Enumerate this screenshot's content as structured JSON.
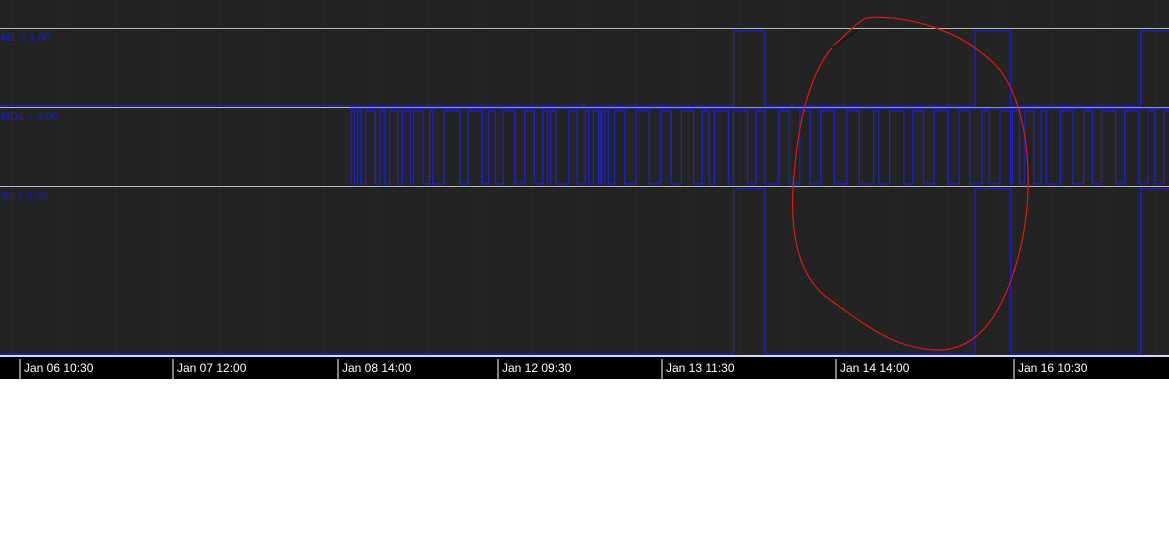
{
  "colors": {
    "panel_background": "#232323",
    "axis_bar": "#000000",
    "signal": "#1f1fcc",
    "annotation": "#e01818",
    "separator": "#b8b8b8",
    "label": "#1a1ad0"
  },
  "chart_data": {
    "type": "line",
    "step": true,
    "grid": true,
    "x_axis": {
      "ticks": [
        "Jan 06 10:30",
        "Jan 07 12:00",
        "Jan 08 14:00",
        "Jan 12 09:30",
        "Jan 13 11:30",
        "Jan 14 14:00",
        "Jan 16 10:30"
      ]
    },
    "panes": [
      {
        "label": "M1 = 1.00",
        "ylim": [
          0,
          1
        ],
        "pulses": [
          [
            4.4,
            4.58
          ],
          [
            5.77,
            5.97
          ],
          [
            6.7,
            6.87
          ]
        ]
      },
      {
        "label": "MD1 = 0.00",
        "ylim": [
          0,
          1
        ],
        "start": 2.06,
        "pulses": [
          [
            2.07,
            2.09
          ],
          [
            2.11,
            2.13
          ],
          [
            2.16,
            2.22
          ],
          [
            2.25,
            2.28
          ],
          [
            2.31,
            2.36
          ],
          [
            2.39,
            2.44
          ],
          [
            2.46,
            2.52
          ],
          [
            2.56,
            2.58
          ],
          [
            2.65,
            2.75
          ],
          [
            2.8,
            2.89
          ],
          [
            2.93,
            2.97
          ],
          [
            3.02,
            3.09
          ],
          [
            3.15,
            3.21
          ],
          [
            3.26,
            3.29
          ],
          [
            3.31,
            3.34
          ],
          [
            3.42,
            3.47
          ],
          [
            3.52,
            3.54
          ],
          [
            3.57,
            3.6
          ],
          [
            3.61,
            3.62
          ],
          [
            3.64,
            3.66
          ],
          [
            3.7,
            3.76
          ],
          [
            3.83,
            3.91
          ],
          [
            3.98,
            4.04
          ],
          [
            4.1,
            4.17
          ],
          [
            4.22,
            4.26
          ],
          [
            4.29,
            4.37
          ],
          [
            4.4,
            4.48
          ],
          [
            4.53,
            4.58
          ],
          [
            4.66,
            4.72
          ],
          [
            4.78,
            4.84
          ],
          [
            4.9,
            4.98
          ],
          [
            5.05,
            5.12
          ],
          [
            5.2,
            5.23
          ],
          [
            5.29,
            5.37
          ],
          [
            5.42,
            5.48
          ],
          [
            5.54,
            5.62
          ],
          [
            5.68,
            5.74
          ],
          [
            5.81,
            5.85
          ],
          [
            5.91,
            5.97
          ],
          [
            5.98,
            6.02
          ],
          [
            6.05,
            6.1
          ],
          [
            6.14,
            6.17
          ],
          [
            6.25,
            6.32
          ],
          [
            6.38,
            6.43
          ],
          [
            6.48,
            6.56
          ],
          [
            6.61,
            6.69
          ],
          [
            6.74,
            6.78
          ],
          [
            6.83,
            6.87
          ],
          [
            6.91,
            6.92
          ]
        ]
      },
      {
        "label": "S1 = 1.00",
        "ylim": [
          0,
          1
        ],
        "pulses": [
          [
            4.4,
            4.58
          ],
          [
            5.77,
            5.97
          ],
          [
            6.7,
            6.87
          ]
        ]
      }
    ]
  }
}
